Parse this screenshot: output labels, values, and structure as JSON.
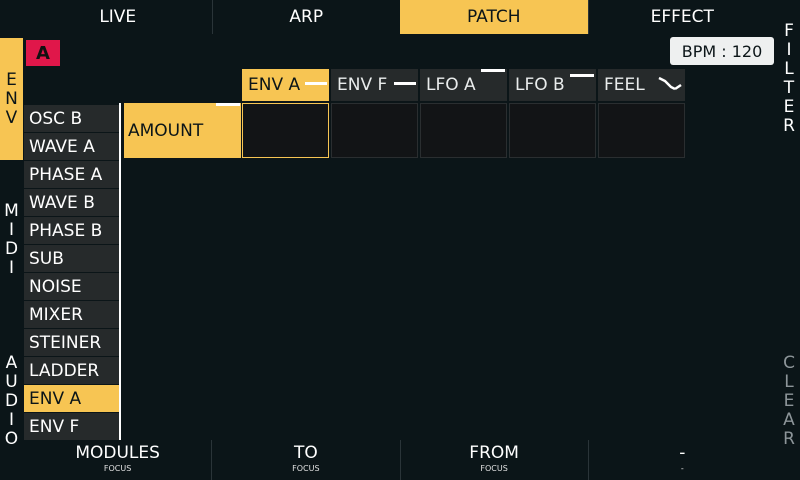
{
  "top_tabs": [
    {
      "label": "LIVE",
      "active": false
    },
    {
      "label": "ARP",
      "active": false
    },
    {
      "label": "PATCH",
      "active": true
    },
    {
      "label": "EFFECT",
      "active": false
    }
  ],
  "left_tabs": [
    {
      "label": "ENV",
      "active": true
    },
    {
      "label": "MIDI",
      "active": false
    },
    {
      "label": "AUDIO",
      "active": false
    }
  ],
  "right_labels": {
    "filter": "FILTER",
    "clear": "CLEAR"
  },
  "badge": "A",
  "bpm": "BPM : 120",
  "columns": [
    {
      "label": "ENV A",
      "active": true,
      "icon": "line-icon"
    },
    {
      "label": "ENV F",
      "active": false,
      "icon": "line-icon"
    },
    {
      "label": "LFO A",
      "active": false,
      "icon": "line-icon"
    },
    {
      "label": "LFO B",
      "active": false,
      "icon": "line-icon"
    },
    {
      "label": "FEEL",
      "active": false,
      "icon": "curve-icon"
    }
  ],
  "modules": [
    {
      "label": "OSC B",
      "active": false
    },
    {
      "label": "WAVE A",
      "active": false
    },
    {
      "label": "PHASE A",
      "active": false
    },
    {
      "label": "WAVE B",
      "active": false
    },
    {
      "label": "PHASE B",
      "active": false
    },
    {
      "label": "SUB",
      "active": false
    },
    {
      "label": "NOISE",
      "active": false
    },
    {
      "label": "MIXER",
      "active": false
    },
    {
      "label": "STEINER",
      "active": false
    },
    {
      "label": "LADDER",
      "active": false
    },
    {
      "label": "ENV A",
      "active": true
    },
    {
      "label": "ENV F",
      "active": false
    }
  ],
  "row": {
    "label": "AMOUNT"
  },
  "bottom": [
    {
      "label": "MODULES",
      "sub": "FOCUS"
    },
    {
      "label": "TO",
      "sub": "FOCUS"
    },
    {
      "label": "FROM",
      "sub": "FOCUS"
    },
    {
      "label": "-",
      "sub": "-"
    }
  ],
  "colors": {
    "accent": "#f7c553",
    "badge": "#e0174a",
    "background": "#0b1518",
    "cell": "#262a2b"
  }
}
